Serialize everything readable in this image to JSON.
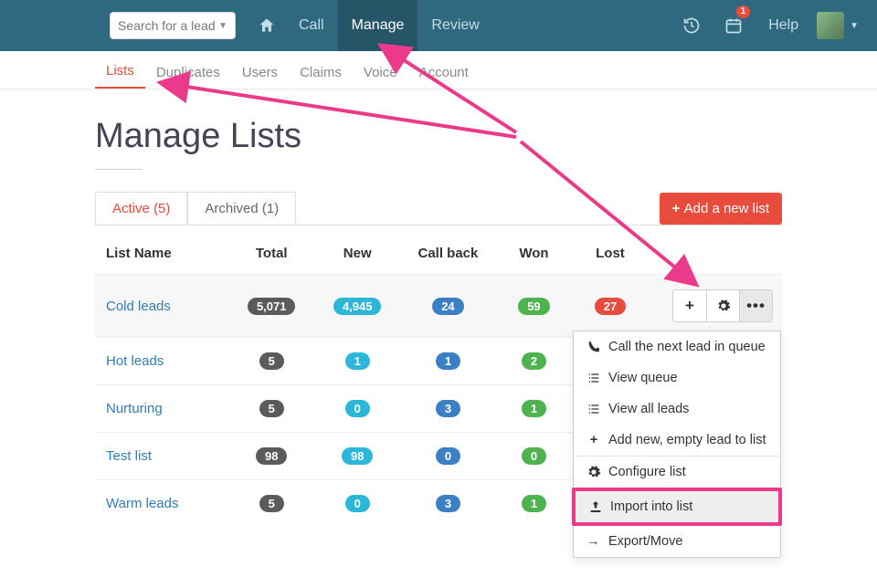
{
  "search": {
    "placeholder": "Search for a lead"
  },
  "nav": {
    "home_icon": "home-icon",
    "call": "Call",
    "manage": "Manage",
    "review": "Review",
    "help": "Help",
    "calendar_badge": "1"
  },
  "subnav": [
    "Lists",
    "Duplicates",
    "Users",
    "Claims",
    "Voice",
    "Account"
  ],
  "page_title": "Manage Lists",
  "tabs": {
    "active": "Active (5)",
    "archived": "Archived (1)"
  },
  "add_button": "Add a new list",
  "columns": [
    "List Name",
    "Total",
    "New",
    "Call back",
    "Won",
    "Lost",
    ""
  ],
  "rows": [
    {
      "name": "Cold leads",
      "total": "5,071",
      "new": "4,945",
      "callback": "24",
      "won": "59",
      "lost": "27",
      "hover": true,
      "actions": true
    },
    {
      "name": "Hot leads",
      "total": "5",
      "new": "1",
      "callback": "1",
      "won": "2",
      "lost": ""
    },
    {
      "name": "Nurturing",
      "total": "5",
      "new": "0",
      "callback": "3",
      "won": "1",
      "lost": ""
    },
    {
      "name": "Test list",
      "total": "98",
      "new": "98",
      "callback": "0",
      "won": "0",
      "lost": ""
    },
    {
      "name": "Warm leads",
      "total": "5",
      "new": "0",
      "callback": "3",
      "won": "1",
      "lost": ""
    }
  ],
  "dropdown": {
    "call_next": "Call the next lead in queue",
    "view_queue": "View queue",
    "view_all": "View all leads",
    "add_lead": "Add new, empty lead to list",
    "configure": "Configure list",
    "import": "Import into list",
    "export": "Export/Move"
  }
}
